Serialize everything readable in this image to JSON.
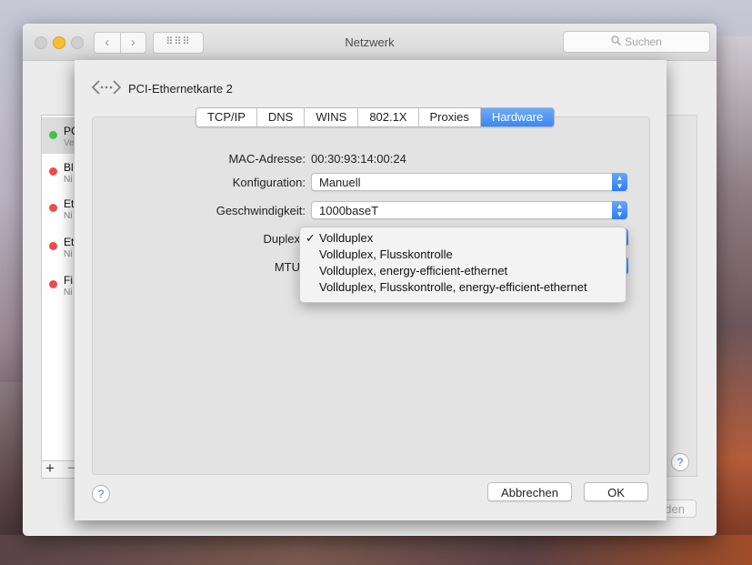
{
  "window": {
    "title": "Netzwerk",
    "search_placeholder": "Suchen",
    "grid_label": "⠿⠿⠿"
  },
  "nav": {
    "back": "‹",
    "forward": "›"
  },
  "sidebar": {
    "items": [
      {
        "name": "PC",
        "sub": "Ve",
        "status": "green"
      },
      {
        "name": "Bl",
        "sub": "Ni",
        "status": "red"
      },
      {
        "name": "Et",
        "sub": "Ni",
        "status": "red"
      },
      {
        "name": "Et",
        "sub": "Ni",
        "status": "red"
      },
      {
        "name": "Fi",
        "sub": "Ni",
        "status": "red"
      }
    ],
    "add": "+",
    "remove": "−"
  },
  "behind_button": "den",
  "help": "?",
  "sheet": {
    "title": "PCI-Ethernetkarte 2",
    "tabs": [
      "TCP/IP",
      "DNS",
      "WINS",
      "802.1X",
      "Proxies",
      "Hardware"
    ],
    "active_tab": "Hardware",
    "mac_label": "MAC-Adresse:",
    "mac_value": "00:30:93:14:00:24",
    "config_label": "Konfiguration:",
    "config_value": "Manuell",
    "speed_label": "Geschwindigkeit:",
    "speed_value": "1000baseT",
    "duplex_label": "Duplex",
    "mtu_label": "MTU",
    "duplex_menu": {
      "checkmark": "✓",
      "options": [
        "Vollduplex",
        "Vollduplex, Flusskontrolle",
        "Vollduplex, energy-efficient-ethernet",
        "Vollduplex, Flusskontrolle, energy-efficient-ethernet"
      ],
      "selected": "Vollduplex"
    },
    "cancel_label": "Abbrechen",
    "ok_label": "OK"
  },
  "colors": {
    "accent": "#3b87f3",
    "status_green": "#3cc53f",
    "status_red": "#ec4d4a"
  }
}
